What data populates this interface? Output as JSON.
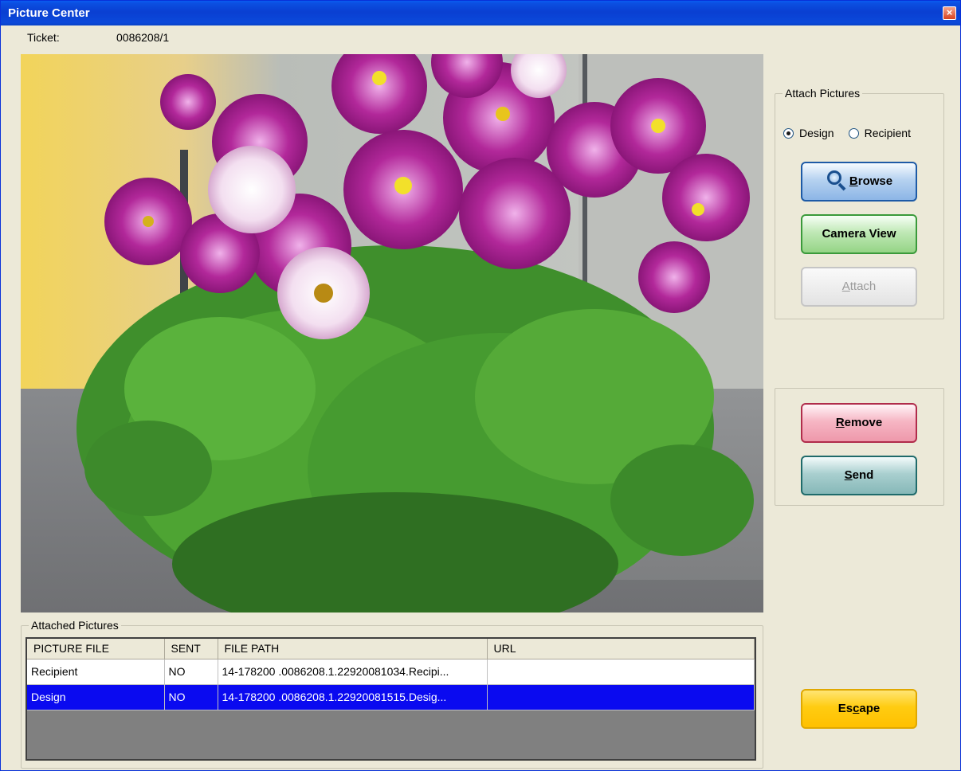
{
  "window": {
    "title": "Picture Center",
    "close_glyph": "×"
  },
  "ticket": {
    "label": "Ticket:",
    "value": "0086208/1"
  },
  "photo": {
    "description_icon": "photo-preview"
  },
  "attach_group": {
    "legend": "Attach Pictures",
    "radios": [
      {
        "label": "Design",
        "checked": true
      },
      {
        "label": "Recipient",
        "checked": false
      }
    ],
    "browse": {
      "prefix": "",
      "accel": "B",
      "rest": "rowse",
      "icon": "magnifier-icon"
    },
    "camera_view": "Camera View",
    "attach": {
      "accel": "A",
      "rest": "ttach"
    }
  },
  "action_group": {
    "remove": {
      "accel": "R",
      "rest": "emove"
    },
    "send": {
      "accel": "S",
      "rest": "end"
    }
  },
  "escape": {
    "pre": "Es",
    "accel": "c",
    "rest": "ape"
  },
  "attached_pictures": {
    "legend": "Attached Pictures",
    "columns": [
      "PICTURE FILE",
      "SENT",
      "FILE PATH",
      "URL"
    ],
    "rows": [
      {
        "picture_file": "Recipient",
        "sent": "NO",
        "file_path": "14-178200  .0086208.1.22920081034.Recipi...",
        "url": ""
      },
      {
        "picture_file": "Design",
        "sent": "NO",
        "file_path": "14-178200  .0086208.1.22920081515.Desig...",
        "url": ""
      }
    ],
    "selected_row": 1
  },
  "colors": {
    "title_bar": "#0a3fd2",
    "selection": "#0a0af0",
    "window_bg": "#ece9d8"
  }
}
